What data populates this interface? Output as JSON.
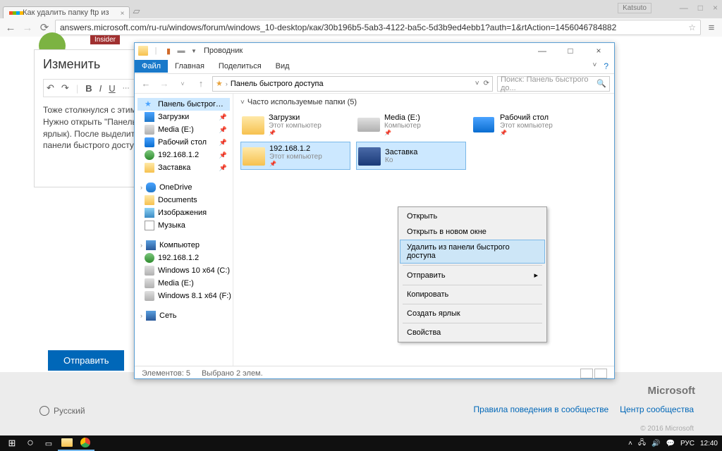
{
  "browser": {
    "tab_title": "Как удалить папку ftp из",
    "user_badge": "Katsuto",
    "url": "answers.microsoft.com/ru-ru/windows/forum/windows_10-desktop/как/30b196b5-5ab3-4122-ba5c-5d3b9ed4ebb1?auth=1&rtAction=1456046784882"
  },
  "page": {
    "insider": "Insider",
    "editor_heading": "Изменить",
    "editor_text": "Тоже столкнулся с этим...\nНужно открыть \"Панель бы\nярлык). После выделить это\nпанели быстрого доступа\"",
    "submit": "Отправить"
  },
  "footer": {
    "lang": "Русский",
    "link1": "Правила поведения в сообществе",
    "link2": "Центр сообщества",
    "ms": "Microsoft",
    "copy": "© 2016 Microsoft"
  },
  "explorer": {
    "title": "Проводник",
    "ribbon": {
      "file": "Файл",
      "home": "Главная",
      "share": "Поделиться",
      "view": "Вид"
    },
    "breadcrumb": "Панель быстрого доступа",
    "search_placeholder": "Поиск: Панель быстрого до...",
    "section_header": "Часто используемые папки (5)",
    "nav": {
      "quick": "Панель быстрого доступа",
      "downloads": "Загрузки",
      "media": "Media (E:)",
      "desktop": "Рабочий стол",
      "ip": "192.168.1.2",
      "zastavka": "Заставка",
      "onedrive": "OneDrive",
      "documents": "Documents",
      "pictures": "Изображения",
      "music": "Музыка",
      "computer": "Компьютер",
      "ip2": "192.168.1.2",
      "win10": "Windows 10 x64 (C:)",
      "media2": "Media (E:)",
      "win81": "Windows 8.1 x64 (F:)",
      "network": "Сеть"
    },
    "folders": [
      {
        "name": "Загрузки",
        "sub": "Этот компьютер"
      },
      {
        "name": "Media (E:)",
        "sub": "Компьютер"
      },
      {
        "name": "Рабочий стол",
        "sub": "Этот компьютер"
      },
      {
        "name": "192.168.1.2",
        "sub": "Этот компьютер"
      },
      {
        "name": "Заставка",
        "sub": "Ко"
      }
    ],
    "ctx": {
      "open": "Открыть",
      "open_new": "Открыть в новом окне",
      "unpin": "Удалить из панели быстрого доступа",
      "send": "Отправить",
      "copy": "Копировать",
      "shortcut": "Создать ярлык",
      "props": "Свойства"
    },
    "status": {
      "count": "Элементов: 5",
      "selected": "Выбрано 2 элем."
    }
  },
  "taskbar": {
    "lang": "РУС",
    "time": "12:40"
  }
}
